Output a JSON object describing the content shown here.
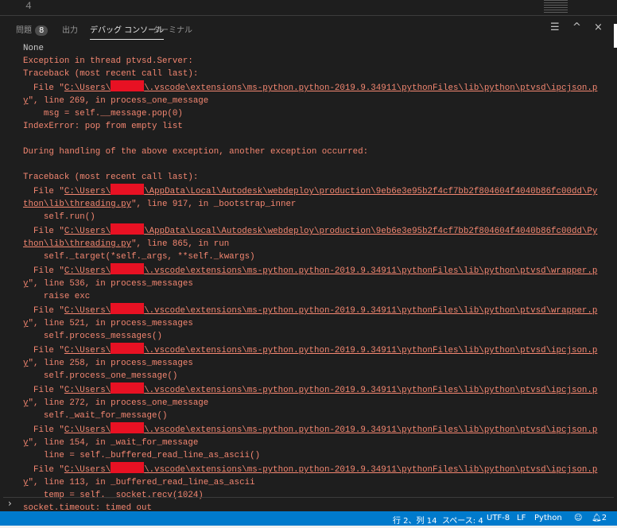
{
  "editor": {
    "line_number": "4"
  },
  "tabs": [
    {
      "label": "問題",
      "badge": "8"
    },
    {
      "label": "出力"
    },
    {
      "label": "デバッグ コンソール",
      "active": true
    },
    {
      "label": "ターミナル"
    }
  ],
  "actions": {
    "clear": "clear-console",
    "collapse": "^",
    "close": "×"
  },
  "console_lines": [
    {
      "cls": "plain",
      "parts": [
        {
          "t": "None"
        }
      ]
    },
    {
      "parts": [
        {
          "t": "Exception in thread ptvsd.Server:"
        }
      ]
    },
    {
      "parts": [
        {
          "t": "Traceback (most recent call last):"
        }
      ]
    },
    {
      "parts": [
        {
          "t": "  File \""
        },
        {
          "t": "C:\\Users\\",
          "u": 1
        },
        {
          "r": 1
        },
        {
          "t": "\\.vscode\\extensions\\ms-python.python-2019.9.34911\\pythonFiles\\lib\\python\\ptvsd\\ipcjson.p",
          "u": 1
        }
      ]
    },
    {
      "parts": [
        {
          "t": "y",
          "u": 1
        },
        {
          "t": "\", line 269, in process_one_message"
        }
      ]
    },
    {
      "parts": [
        {
          "t": "    msg = self.__message.pop(0)"
        }
      ]
    },
    {
      "parts": [
        {
          "t": "IndexError: pop from empty list"
        }
      ]
    },
    {
      "parts": [
        {
          "t": ""
        }
      ]
    },
    {
      "parts": [
        {
          "t": "During handling of the above exception, another exception occurred:"
        }
      ]
    },
    {
      "parts": [
        {
          "t": ""
        }
      ]
    },
    {
      "parts": [
        {
          "t": "Traceback (most recent call last):"
        }
      ]
    },
    {
      "parts": [
        {
          "t": "  File \""
        },
        {
          "t": "C:\\Users\\",
          "u": 1
        },
        {
          "r": 1
        },
        {
          "t": "\\AppData\\Local\\Autodesk\\webdeploy\\production\\9eb6e3e95b2f4cf7bb2f804604f4040b86fc00dd\\Py",
          "u": 1
        }
      ]
    },
    {
      "parts": [
        {
          "t": "thon\\lib\\threading.py",
          "u": 1
        },
        {
          "t": "\", line 917, in _bootstrap_inner"
        }
      ]
    },
    {
      "parts": [
        {
          "t": "    self.run()"
        }
      ]
    },
    {
      "parts": [
        {
          "t": "  File \""
        },
        {
          "t": "C:\\Users\\",
          "u": 1
        },
        {
          "r": 1
        },
        {
          "t": "\\AppData\\Local\\Autodesk\\webdeploy\\production\\9eb6e3e95b2f4cf7bb2f804604f4040b86fc00dd\\Py",
          "u": 1
        }
      ]
    },
    {
      "parts": [
        {
          "t": "thon\\lib\\threading.py",
          "u": 1
        },
        {
          "t": "\", line 865, in run"
        }
      ]
    },
    {
      "parts": [
        {
          "t": "    self._target(*self._args, **self._kwargs)"
        }
      ]
    },
    {
      "parts": [
        {
          "t": "  File \""
        },
        {
          "t": "C:\\Users\\",
          "u": 1
        },
        {
          "r": 1
        },
        {
          "t": "\\.vscode\\extensions\\ms-python.python-2019.9.34911\\pythonFiles\\lib\\python\\ptvsd\\wrapper.p",
          "u": 1
        }
      ]
    },
    {
      "parts": [
        {
          "t": "y",
          "u": 1
        },
        {
          "t": "\", line 536, in process_messages"
        }
      ]
    },
    {
      "parts": [
        {
          "t": "    raise exc"
        }
      ]
    },
    {
      "parts": [
        {
          "t": "  File \""
        },
        {
          "t": "C:\\Users\\",
          "u": 1
        },
        {
          "r": 1
        },
        {
          "t": "\\.vscode\\extensions\\ms-python.python-2019.9.34911\\pythonFiles\\lib\\python\\ptvsd\\wrapper.p",
          "u": 1
        }
      ]
    },
    {
      "parts": [
        {
          "t": "y",
          "u": 1
        },
        {
          "t": "\", line 521, in process_messages"
        }
      ]
    },
    {
      "parts": [
        {
          "t": "    self.process_messages()"
        }
      ]
    },
    {
      "parts": [
        {
          "t": "  File \""
        },
        {
          "t": "C:\\Users\\",
          "u": 1
        },
        {
          "r": 1
        },
        {
          "t": "\\.vscode\\extensions\\ms-python.python-2019.9.34911\\pythonFiles\\lib\\python\\ptvsd\\ipcjson.p",
          "u": 1
        }
      ]
    },
    {
      "parts": [
        {
          "t": "y",
          "u": 1
        },
        {
          "t": "\", line 258, in process_messages"
        }
      ]
    },
    {
      "parts": [
        {
          "t": "    self.process_one_message()"
        }
      ]
    },
    {
      "parts": [
        {
          "t": "  File \""
        },
        {
          "t": "C:\\Users\\",
          "u": 1
        },
        {
          "r": 1
        },
        {
          "t": "\\.vscode\\extensions\\ms-python.python-2019.9.34911\\pythonFiles\\lib\\python\\ptvsd\\ipcjson.p",
          "u": 1
        }
      ]
    },
    {
      "parts": [
        {
          "t": "y",
          "u": 1
        },
        {
          "t": "\", line 272, in process_one_message"
        }
      ]
    },
    {
      "parts": [
        {
          "t": "    self._wait_for_message()"
        }
      ]
    },
    {
      "parts": [
        {
          "t": "  File \""
        },
        {
          "t": "C:\\Users\\",
          "u": 1
        },
        {
          "r": 1
        },
        {
          "t": "\\.vscode\\extensions\\ms-python.python-2019.9.34911\\pythonFiles\\lib\\python\\ptvsd\\ipcjson.p",
          "u": 1
        }
      ]
    },
    {
      "parts": [
        {
          "t": "y",
          "u": 1
        },
        {
          "t": "\", line 154, in _wait_for_message"
        }
      ]
    },
    {
      "parts": [
        {
          "t": "    line = self._buffered_read_line_as_ascii()"
        }
      ]
    },
    {
      "parts": [
        {
          "t": "  File \""
        },
        {
          "t": "C:\\Users\\",
          "u": 1
        },
        {
          "r": 1
        },
        {
          "t": "\\.vscode\\extensions\\ms-python.python-2019.9.34911\\pythonFiles\\lib\\python\\ptvsd\\ipcjson.p",
          "u": 1
        }
      ]
    },
    {
      "parts": [
        {
          "t": "y",
          "u": 1
        },
        {
          "t": "\", line 113, in _buffered_read_line_as_ascii"
        }
      ]
    },
    {
      "parts": [
        {
          "t": "    temp = self.__socket.recv(1024)"
        }
      ]
    },
    {
      "parts": [
        {
          "t": "socket.timeout: timed out"
        }
      ]
    }
  ],
  "prompt": "›",
  "status": {
    "position": "行 2、列 14",
    "spaces": "スペース: 4",
    "encoding": "UTF-8",
    "eol": "LF",
    "language": "Python",
    "notifications": "2"
  }
}
